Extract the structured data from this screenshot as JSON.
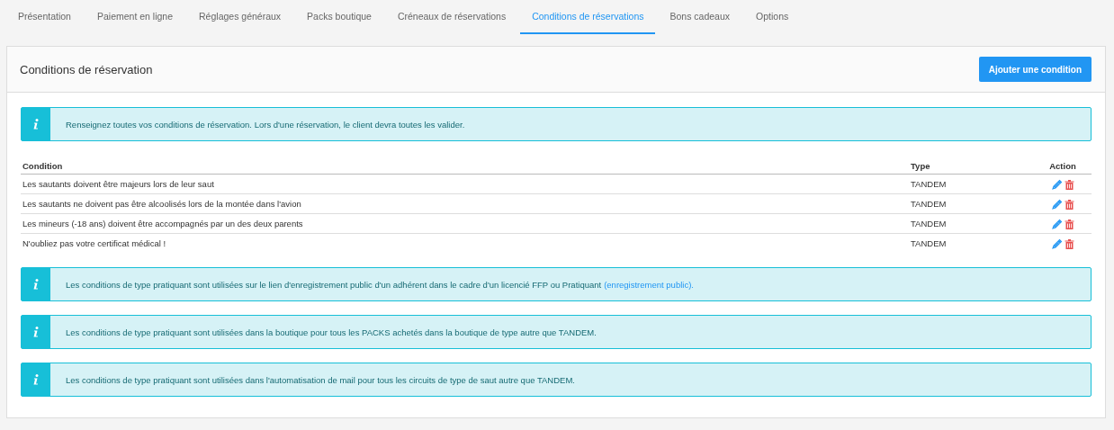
{
  "tabs": [
    {
      "label": "Présentation",
      "selected": false
    },
    {
      "label": "Paiement en ligne",
      "selected": false
    },
    {
      "label": "Réglages généraux",
      "selected": false
    },
    {
      "label": "Packs boutique",
      "selected": false
    },
    {
      "label": "Créneaux de réservations",
      "selected": false
    },
    {
      "label": "Conditions de réservations",
      "selected": true
    },
    {
      "label": "Bons cadeaux",
      "selected": false
    },
    {
      "label": "Options",
      "selected": false
    }
  ],
  "panel": {
    "title": "Conditions de réservation",
    "add_button": "Ajouter une condition",
    "intro_alert": {
      "text": "Renseignez toutes vos conditions de réservation. Lors d'une réservation, le client devra toutes les valider."
    },
    "table": {
      "columns": [
        "Condition",
        "Type",
        "Action"
      ],
      "rows": [
        {
          "condition": "Les sautants doivent être majeurs lors de leur saut",
          "type": "TANDEM"
        },
        {
          "condition": "Les sautants ne doivent pas être alcoolisés lors de la montée dans l'avion",
          "type": "TANDEM"
        },
        {
          "condition": "Les mineurs (-18 ans) doivent être accompagnés par un des deux parents",
          "type": "TANDEM"
        },
        {
          "condition": "N'oubliez pas votre certificat médical !",
          "type": "TANDEM"
        }
      ]
    },
    "alerts": [
      {
        "text": "Les conditions de type pratiquant sont utilisées sur le lien d'enregistrement public d'un adhérent dans le cadre d'un licencié FFP ou Pratiquant",
        "link": "(enregistrement public)."
      },
      {
        "text": "Les conditions de type pratiquant sont utilisées dans la boutique pour tous les PACKS achetés dans la boutique de type autre que TANDEM."
      },
      {
        "text": "Les conditions de type pratiquant sont utilisées dans l'automatisation de mail pour tous les circuits de type de saut autre que TANDEM."
      }
    ]
  }
}
